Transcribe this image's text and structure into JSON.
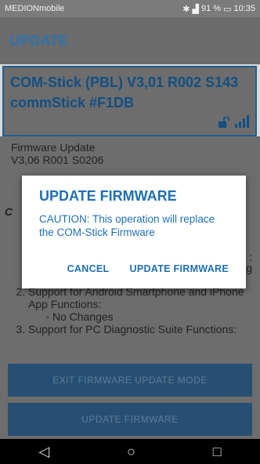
{
  "status_bar": {
    "carrier": "MEDIONmobile",
    "battery": "91 %",
    "time": "10:35"
  },
  "app_bar": {
    "title": "UPDATE"
  },
  "device": {
    "line1": "COM-Stick (PBL) V3,01 R002 S143",
    "line2": "commStick #F1DB"
  },
  "content": {
    "fw_label": "Firmware Update",
    "fw_version": "V3,06 R001 S0206",
    "frag_c": "C",
    "frag_colon": ":",
    "frag_g": "g",
    "list": [
      "Support for Android Smartphone and iPhone App Functions:",
      "Support for PC Diagnostic Suite Functions:"
    ],
    "list_sub": "No Changes"
  },
  "buttons": {
    "exit": "EXIT FIRMWARE UPDATE MODE",
    "update": "UPDATE FIRMWARE"
  },
  "dialog": {
    "title": "UPDATE FIRMWARE",
    "message": "CAUTION: This operation will replace the COM-Stick Firmware",
    "cancel": "CANCEL",
    "confirm": "UPDATE FIRMWARE"
  },
  "icons": {
    "back": "back-icon",
    "home": "home-icon",
    "recents": "recents-icon"
  }
}
